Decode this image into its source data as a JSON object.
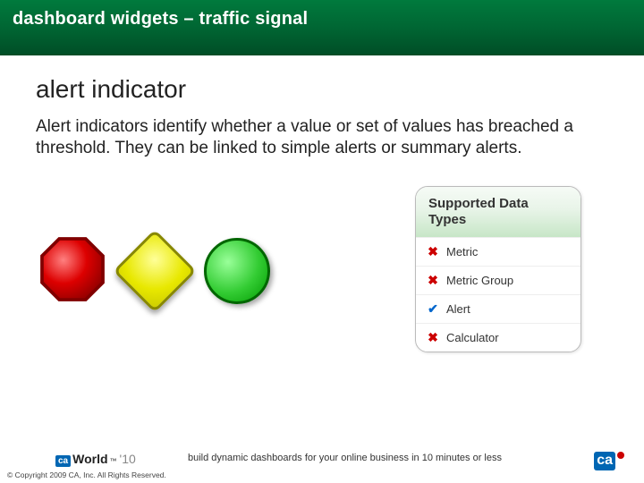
{
  "header": {
    "title": "dashboard widgets – traffic signal"
  },
  "section": {
    "title": "alert indicator",
    "body": "Alert indicators identify whether a value or set of values has breached a threshold.  They can be linked to simple alerts or summary alerts."
  },
  "signals": [
    {
      "name": "stop-octagon",
      "color_fill": "#cc0000",
      "color_stroke": "#800000"
    },
    {
      "name": "caution-diamond",
      "color_fill": "#e8e800",
      "color_stroke": "#888800"
    },
    {
      "name": "go-circle",
      "color_fill": "#33cc33",
      "color_stroke": "#006600"
    }
  ],
  "data_types": {
    "header": "Supported Data Types",
    "rows": [
      {
        "supported": false,
        "label": "Metric"
      },
      {
        "supported": false,
        "label": "Metric Group"
      },
      {
        "supported": true,
        "label": "Alert"
      },
      {
        "supported": false,
        "label": "Calculator"
      }
    ]
  },
  "footer": {
    "tagline": "build dynamic dashboards for your online business in 10 minutes or less",
    "copyright": "© Copyright 2009 CA, Inc. All Rights Reserved.",
    "ca_world": {
      "ca": "ca",
      "world": "World",
      "tm": "™",
      "year": "'10"
    },
    "corner": {
      "ca": "ca"
    }
  }
}
